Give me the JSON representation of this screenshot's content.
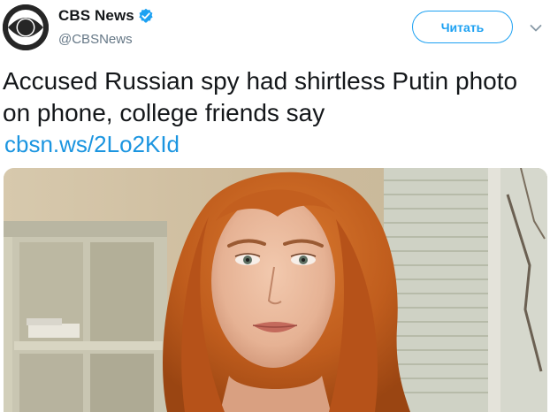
{
  "header": {
    "display_name": "CBS News",
    "handle": "@CBSNews",
    "follow_label": "Читать"
  },
  "tweet": {
    "text": "Accused Russian spy had shirtless Putin photo on phone, college friends say",
    "link": "cbsn.ws/2Lo2KId"
  },
  "colors": {
    "accent": "#1da1f2",
    "link": "#1b95e0",
    "handle": "#657786",
    "verified": "#1da1f2"
  },
  "icons": {
    "avatar": "cbs-eye-logo-icon",
    "verified": "verified-badge-icon",
    "menu": "chevron-down-icon"
  }
}
